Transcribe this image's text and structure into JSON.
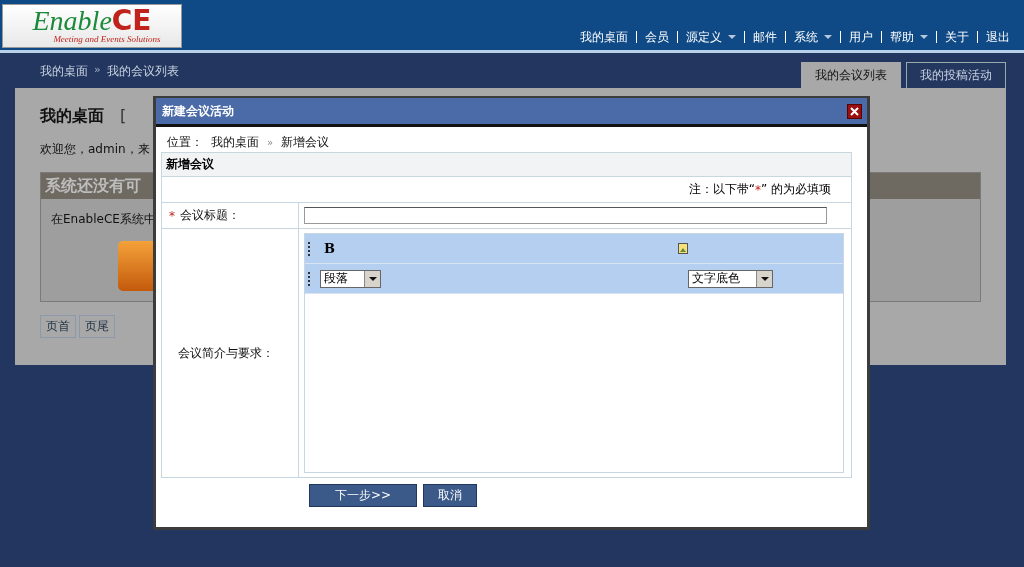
{
  "logo": {
    "word": "Enable",
    "accent": "CE",
    "tagline": "Meeting and Events Solutions"
  },
  "nav": [
    {
      "label": "我的桌面",
      "dropdown": false
    },
    {
      "label": "会员",
      "dropdown": false
    },
    {
      "label": "源定义",
      "dropdown": true
    },
    {
      "label": "邮件",
      "dropdown": false
    },
    {
      "label": "系统",
      "dropdown": true
    },
    {
      "label": "用户",
      "dropdown": false
    },
    {
      "label": "帮助",
      "dropdown": true
    },
    {
      "label": "关于",
      "dropdown": false
    },
    {
      "label": "退出",
      "dropdown": false
    }
  ],
  "breadcrumb": [
    {
      "kind": "link",
      "text": "我的桌面"
    },
    {
      "kind": "separator",
      "text": "»"
    },
    {
      "kind": "link",
      "text": "我的会议列表"
    }
  ],
  "tabs": [
    {
      "label": "我的会议列表",
      "selected": true
    },
    {
      "label": "我的投稿活动",
      "selected": false
    }
  ],
  "desktop": {
    "title": "我的桌面",
    "bracket": "[",
    "welcome": "欢迎您，admin，来",
    "notice_title": "系统还没有可",
    "notice_text": "在EnableCE系统中"
  },
  "pager": [
    "页首",
    "页尾"
  ],
  "dialog": {
    "title": "新建会议活动",
    "location_label": "位置：",
    "location": [
      {
        "kind": "link",
        "text": "我的桌面"
      },
      {
        "kind": "separator",
        "text": "»"
      },
      {
        "kind": "current",
        "text": "新增会议"
      }
    ],
    "section": "新增会议",
    "note": {
      "before": "注：以下带“",
      "mark": "*",
      "after": "” 的为必填项"
    },
    "fields": [
      {
        "kind": "text",
        "label": "会议标题：",
        "required": true
      },
      {
        "kind": "editor",
        "label": "会议简介与要求：",
        "required": false
      }
    ],
    "toolbar": {
      "bold": "B",
      "selects": [
        "段落",
        "文字底色"
      ]
    },
    "buttons": [
      "下一步>>",
      "取消"
    ]
  }
}
